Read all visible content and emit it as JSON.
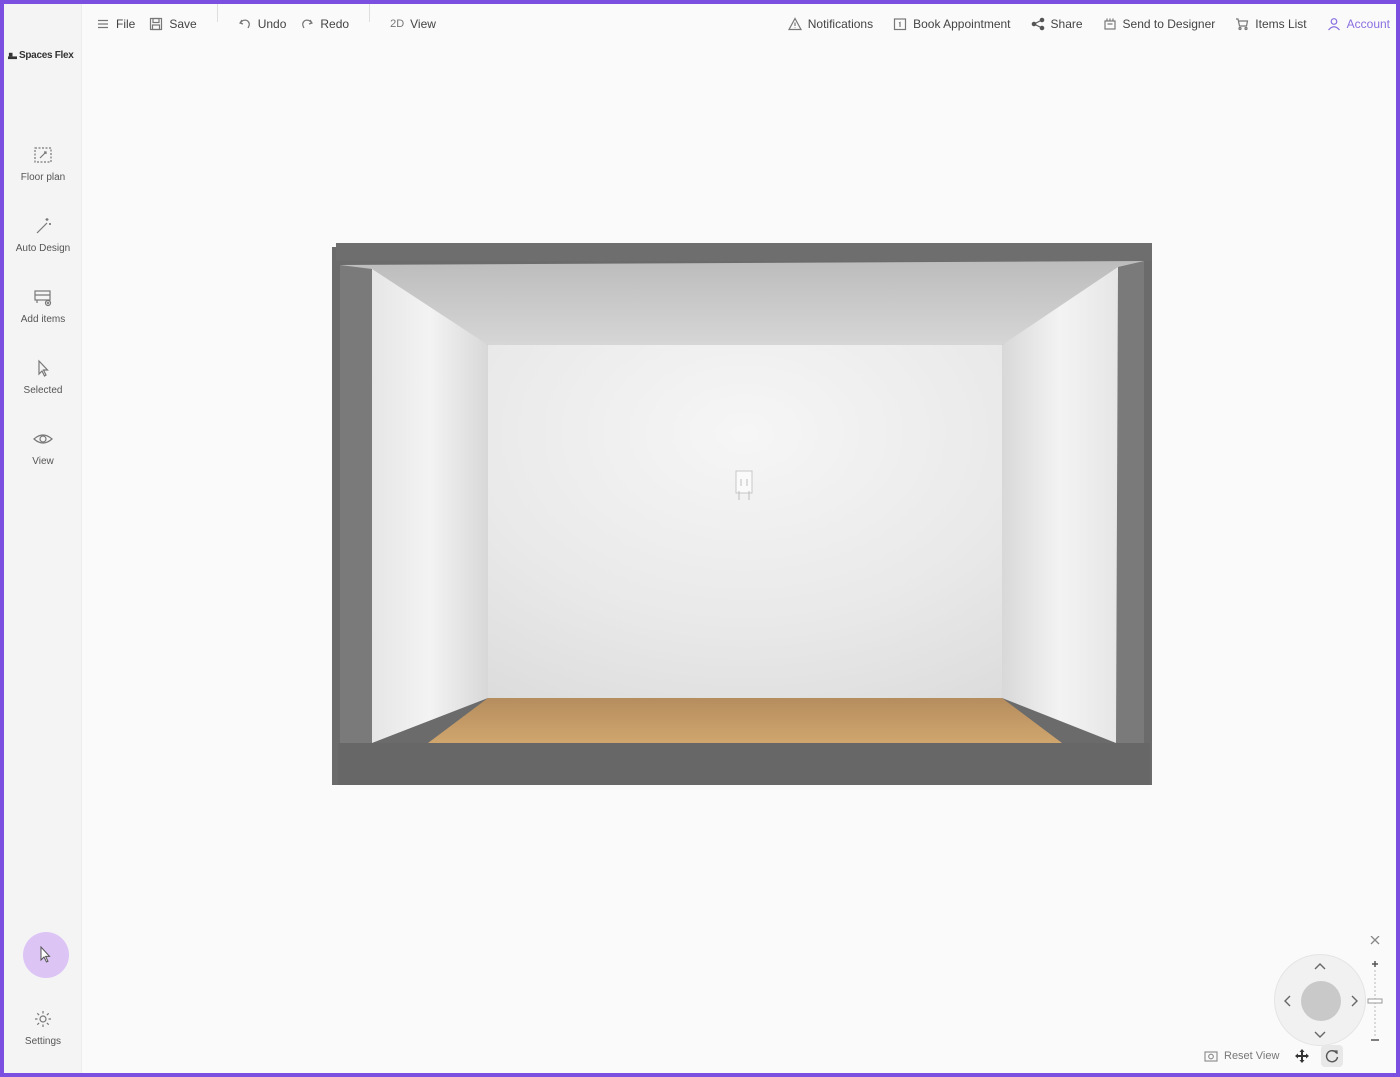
{
  "app": {
    "logo_text": "Spaces Flex"
  },
  "toolbar": {
    "file": "File",
    "save": "Save",
    "undo": "Undo",
    "redo": "Redo",
    "view_2d_prefix": "2D",
    "view_2d_label": "View",
    "notifications": "Notifications",
    "book_appointment": "Book Appointment",
    "share": "Share",
    "send_to_designer": "Send to Designer",
    "items_list": "Items List",
    "account": "Account"
  },
  "sidebar": {
    "items": [
      {
        "label": "Floor plan",
        "icon": "floor-plan-icon"
      },
      {
        "label": "Auto Design",
        "icon": "magic-wand-icon"
      },
      {
        "label": "Add items",
        "icon": "add-items-icon"
      },
      {
        "label": "Selected",
        "icon": "cursor-icon"
      },
      {
        "label": "View",
        "icon": "eye-icon"
      }
    ],
    "settings_label": "Settings"
  },
  "viewport": {
    "reset_view_label": "Reset View"
  },
  "colors": {
    "frame_border": "#7b4fe0",
    "accent": "#8a6fe0",
    "cursor_bubble": "#dcc4f5",
    "floor": "#c9a06a",
    "wall_outer": "#6b6b6b"
  }
}
